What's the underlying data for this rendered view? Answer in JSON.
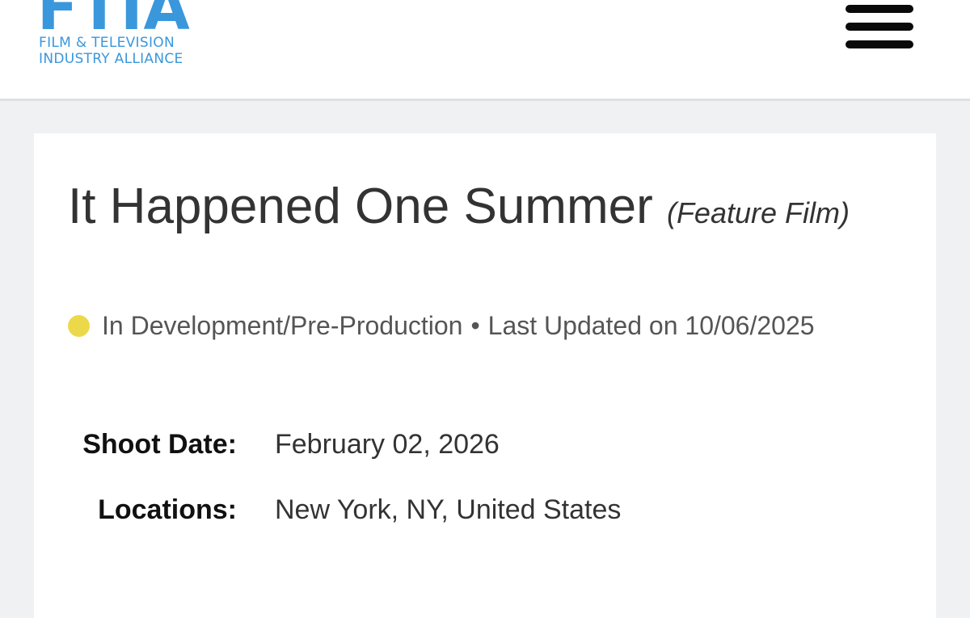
{
  "header": {
    "logo_text": "FTIA",
    "logo_subline_1": "FILM & TELEVISION",
    "logo_subline_2": "INDUSTRY ALLIANCE",
    "menu_icon": "hamburger-menu-icon",
    "brand_color": "#3a97dc"
  },
  "project": {
    "title": "It Happened One Summer",
    "type": "(Feature Film)",
    "status": "In Development/Pre-Production",
    "status_color": "#ecd94a",
    "separator": "•",
    "last_updated": "Last Updated on 10/06/2025"
  },
  "details": [
    {
      "label": "Shoot Date:",
      "value": "February 02, 2026"
    },
    {
      "label": "Locations:",
      "value": "New York, NY, United States"
    }
  ]
}
